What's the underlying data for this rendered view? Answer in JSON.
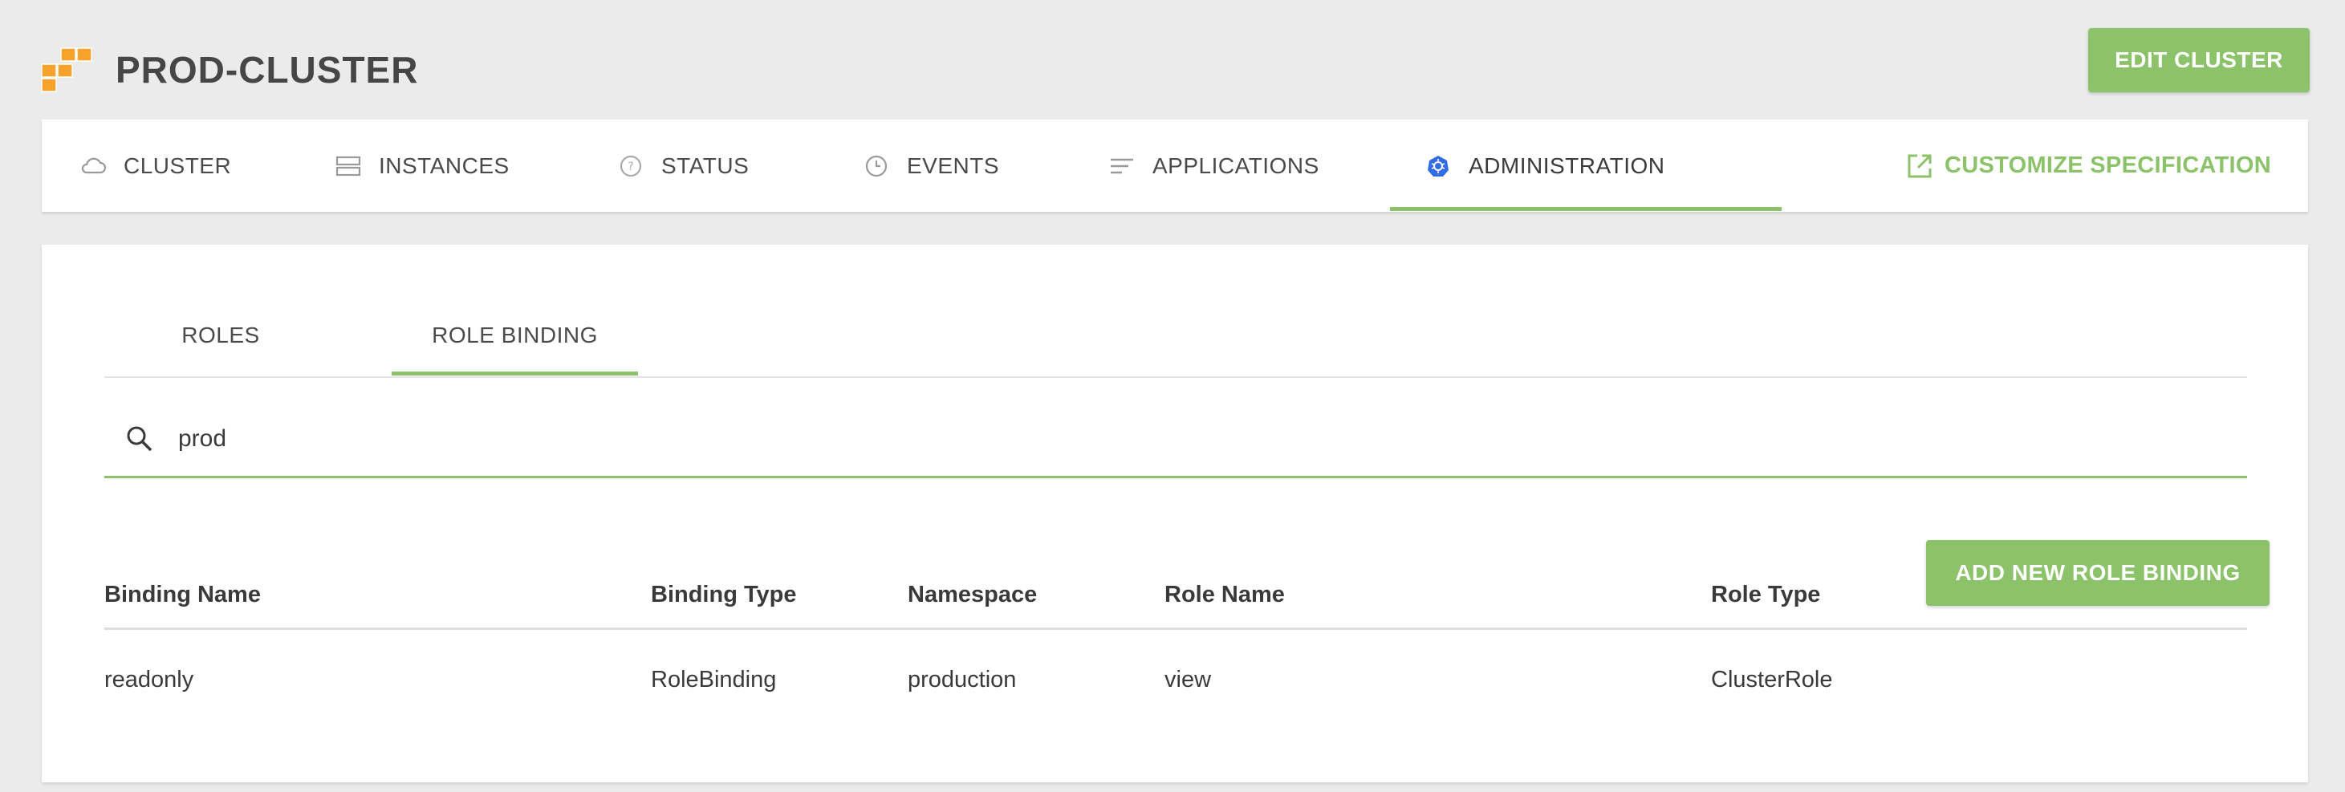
{
  "header": {
    "title": "PROD-CLUSTER",
    "edit_label": "EDIT CLUSTER",
    "logo_icon": "aws-cubes-icon"
  },
  "nav": {
    "tabs": [
      {
        "label": "CLUSTER",
        "icon": "cloud-icon"
      },
      {
        "label": "INSTANCES",
        "icon": "server-icon"
      },
      {
        "label": "STATUS",
        "icon": "help-circle-icon"
      },
      {
        "label": "EVENTS",
        "icon": "clock-icon"
      },
      {
        "label": "APPLICATIONS",
        "icon": "list-icon"
      },
      {
        "label": "ADMINISTRATION",
        "icon": "kubernetes-icon"
      }
    ],
    "active_tab": "ADMINISTRATION",
    "customize_label": "CUSTOMIZE SPECIFICATION"
  },
  "admin": {
    "sub_tabs": [
      {
        "label": "ROLES"
      },
      {
        "label": "ROLE BINDING"
      }
    ],
    "active_sub_tab": "ROLE BINDING",
    "search": {
      "value": "prod",
      "placeholder": ""
    },
    "add_label": "ADD NEW ROLE BINDING",
    "table": {
      "columns": [
        "Binding Name",
        "Binding Type",
        "Namespace",
        "Role Name",
        "Role Type"
      ],
      "rows": [
        [
          "readonly",
          "RoleBinding",
          "production",
          "view",
          "ClusterRole"
        ]
      ]
    }
  },
  "colors": {
    "accent": "#8cc269",
    "background": "#ebebeb",
    "aws_orange": "#f7a22b",
    "k8s_blue": "#326ce5"
  }
}
